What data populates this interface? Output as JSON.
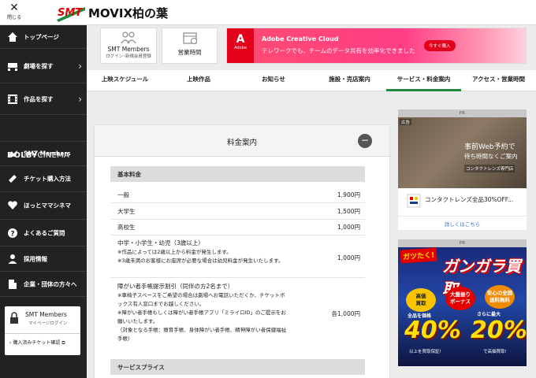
{
  "header": {
    "close_label": "閉じる",
    "logo_text": "SMT",
    "theater_name": "MOVIX柏の葉"
  },
  "sidebar": {
    "items": [
      {
        "label": "トップページ",
        "icon": "home-icon"
      },
      {
        "label": "劇場を探す",
        "icon": "theater-icon"
      },
      {
        "label": "作品を探す",
        "icon": "film-icon"
      },
      {
        "label": "SMT Members",
        "icon": "members-icon"
      },
      {
        "label": "チケット購入方法",
        "icon": "ticket-icon"
      },
      {
        "label": "ほっとママシネマ",
        "icon": "heart-icon"
      },
      {
        "label": "よくあるご質問",
        "icon": "question-icon"
      },
      {
        "label": "採用情報",
        "icon": "person-icon"
      },
      {
        "label": "企業・団体の方々へ",
        "icon": "building-icon"
      }
    ],
    "dolby_label_bold": "DOLBY",
    "dolby_label_rest": "CINEMA",
    "member_box": {
      "title": "SMT Members",
      "subtitle": "マイページログイン",
      "link": "購入済みチケット確認"
    }
  },
  "tiles": {
    "members_title": "SMT Members",
    "members_sub": "ログイン･新規会員登録",
    "hours_title": "営業時間"
  },
  "ad_top": {
    "brand": "Adobe",
    "headline": "Adobe Creative Cloud",
    "body": "テレワークでも、チームのデータ共有を効率化できました",
    "cta": "今すぐ購入"
  },
  "nav": {
    "items": [
      "上映スケジュール",
      "上映作品",
      "お知らせ",
      "施設・売店案内",
      "サービス・料金案内",
      "アクセス・営業時間"
    ],
    "active_index": 4
  },
  "pricing": {
    "title": "料金案内",
    "collapse_symbol": "−",
    "section_basic": "基本料金",
    "section_service": "サービスプライス",
    "rows": [
      {
        "label": "一般",
        "price": "1,900円"
      },
      {
        "label": "大学生",
        "price": "1,500円"
      },
      {
        "label": "高校生",
        "price": "1,000円"
      },
      {
        "label": "中学・小学生・幼児（3歳以上）",
        "notes": [
          "※作品によっては2歳以上から料金が発生します。",
          "※3歳未満のお客様にお座席が必要な場合は幼児料金が発生いたしま",
          "す。"
        ],
        "price": "1,000円"
      },
      {
        "label": "障がい者手帳提示割引（同伴の方2名まで）",
        "notes": [
          "※車椅子スペースをご希望の場合は劇場へお電話いただくか、チケットボ",
          "ックス有人窓口までお越しください。",
          "※障がい者手帳もしくは障がい者手帳アプリ「ミライロID」のご提示をお",
          "願いいたします。",
          "（対象となる手帳：療育手帳、身体障がい者手帳、精神障がい者保健福祉",
          "手帳）"
        ],
        "price": "各1,000円"
      }
    ]
  },
  "ads_right": {
    "pr_label": "PR",
    "ad1": {
      "badge": "広告",
      "line1": "事前Web予約で",
      "line2": "待ち時間なくご案内",
      "line3": "コンタクトレンズ専門店",
      "shop_label": "コンタクトレンズ全品30%OFF...",
      "more": "詳しくはこちら"
    },
    "ad2": {
      "logo": "ガツたく!",
      "headline": "ガンガラ買取",
      "pill1": "高価\n買取",
      "pill2": "大盤振り\nボーナス",
      "pill3": "安心の全国\n送料無料",
      "mini1": "全品を価格",
      "mini2": "さらに最大",
      "pct1": "40%",
      "pct2": "20%",
      "mini3": "以上を買取保証!",
      "mini4": "で高価買取!"
    }
  },
  "colors": {
    "sidebar_bg": "#222222",
    "nav_active": "#1f8a3a",
    "adobe_red": "#e2001a",
    "link_blue": "#3a6fb5"
  }
}
